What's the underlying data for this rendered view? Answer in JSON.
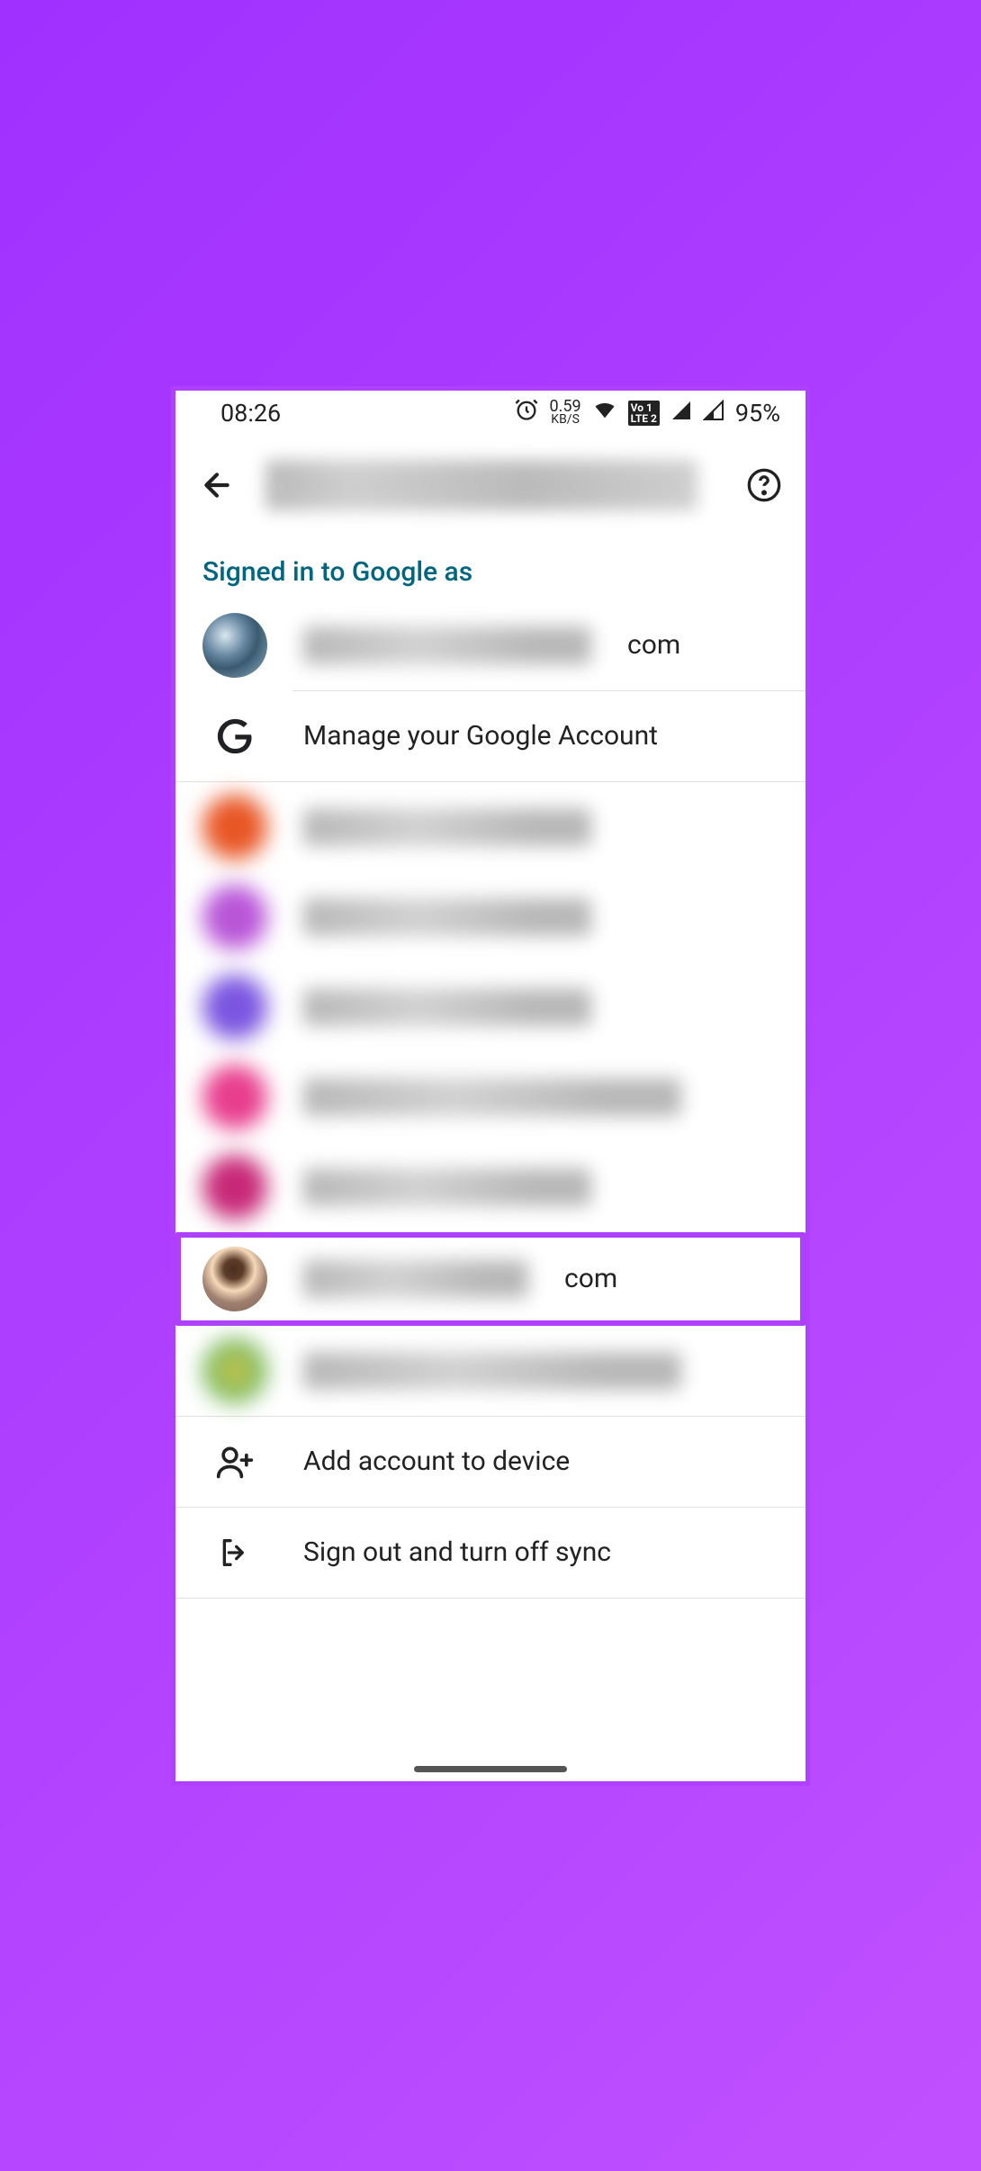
{
  "statusbar": {
    "time": "08:26",
    "netspeed_num": "0.59",
    "netspeed_unit": "KB/S",
    "lte": "Vo 1 LTE 2",
    "battery": "95%"
  },
  "section": {
    "signed_in_as": "Signed in to Google as"
  },
  "primary_account": {
    "suffix": "com"
  },
  "manage_account": {
    "label": "Manage your Google Account"
  },
  "highlighted_account": {
    "suffix": "com"
  },
  "actions": {
    "add_account": "Add account to device",
    "sign_out": "Sign out and turn off sync"
  }
}
